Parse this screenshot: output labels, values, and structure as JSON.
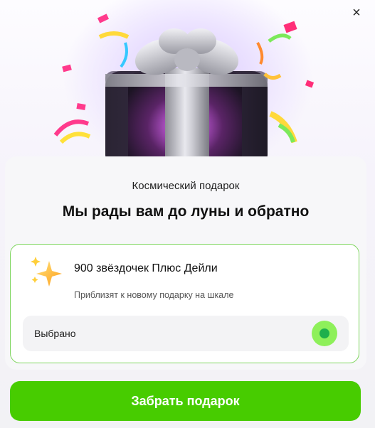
{
  "dialog": {
    "close_symbol": "×",
    "subtitle": "Космический подарок",
    "headline": "Мы рады вам до луны и обратно"
  },
  "offer": {
    "icon": "sparkle-stars-icon",
    "title": "900 звёздочек Плюс Дейли",
    "description": "Приблизят к новому подарку на шкале",
    "selected_label": "Выбрано",
    "selected": true
  },
  "cta": {
    "label": "Забрать подарок"
  },
  "colors": {
    "accent": "#47cc00",
    "offer_border": "#7fd65f",
    "radio_outer": "#8ef05a",
    "radio_inner": "#1fb04c"
  }
}
